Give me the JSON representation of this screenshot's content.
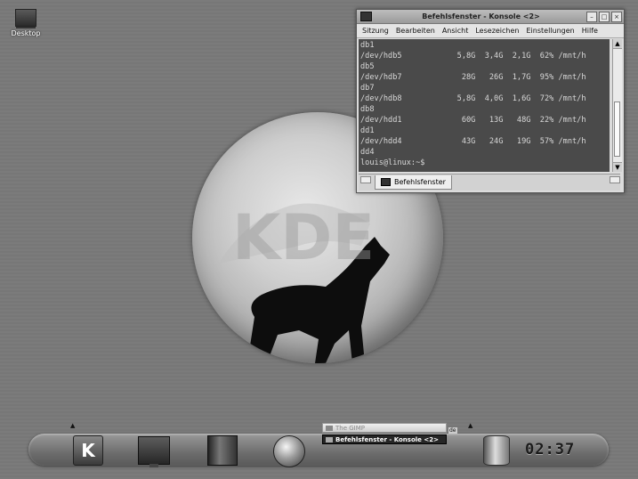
{
  "desktop": {
    "icon_label": "Desktop"
  },
  "window": {
    "title": "Befehlsfenster - Konsole <2>",
    "menu": [
      "Sitzung",
      "Bearbeiten",
      "Ansicht",
      "Lesezeichen",
      "Einstellungen",
      "Hilfe"
    ],
    "terminal_lines": [
      "db1",
      "/dev/hdb5            5,8G  3,4G  2,1G  62% /mnt/h",
      "db5",
      "/dev/hdb7             28G   26G  1,7G  95% /mnt/h",
      "db7",
      "/dev/hdb8            5,8G  4,0G  1,6G  72% /mnt/h",
      "db8",
      "/dev/hdd1             60G   13G   48G  22% /mnt/h",
      "dd1",
      "/dev/hdd4             43G   24G   19G  57% /mnt/h",
      "dd4",
      "louis@linux:~$"
    ],
    "tab_label": "Befehlsfenster"
  },
  "taskbar": {
    "tasks": [
      "The GIMP",
      "Befehlsfenster - Konsole <2>"
    ],
    "desktop_indicator": "de",
    "clock": "02:37",
    "kmenu_label": "K"
  }
}
